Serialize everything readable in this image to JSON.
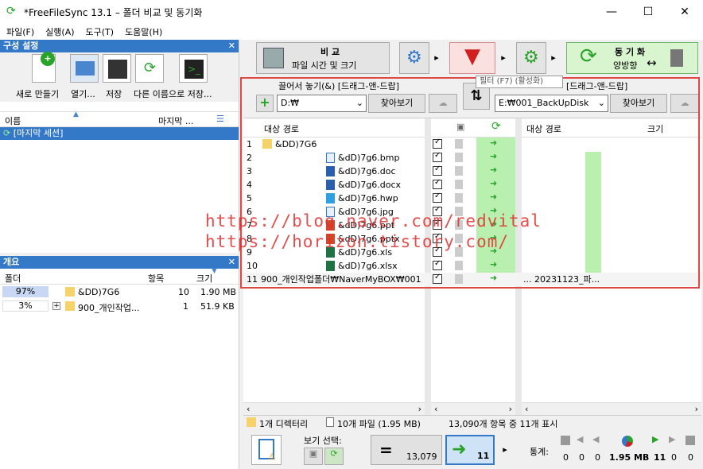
{
  "window": {
    "title": "*FreeFileSync 13.1 – 폴더 비교 및 동기화",
    "min": "—",
    "max": "☐",
    "close": "✕"
  },
  "menu": [
    "파일(F)",
    "실행(A)",
    "도구(T)",
    "도움말(H)"
  ],
  "config_panel": {
    "title": "구성 설정",
    "close": "✕",
    "buttons": [
      "새로 만들기",
      "열기...",
      "저장",
      "다른 이름으로 저장..."
    ],
    "col_name": "이름",
    "col_last": "마지막 ...",
    "session": "[마지막 세션]"
  },
  "overview_panel": {
    "title": "개요",
    "close": "✕",
    "col_folder": "폴더",
    "col_items": "항목",
    "col_size": "크기",
    "rows": [
      {
        "pct": "97%",
        "name": "&DD)7G6",
        "items": "10",
        "size": "1.90 MB"
      },
      {
        "pct": "3%",
        "name": "900_개인작업...",
        "items": "1",
        "size": "51.9 KB"
      }
    ]
  },
  "toolbar": {
    "compare_label": "비 교",
    "compare_sub": "파일 시간 및 크기",
    "sync_label": "동 기 화",
    "sync_sub": "양방향",
    "tooltip": "필터 (F7) (활성화)"
  },
  "left_folder": {
    "drop_label": "끌어서 놓기(&) [드래그-앤-드랍]",
    "path": "D:₩",
    "browse": "찾아보기"
  },
  "right_folder": {
    "drop_label": "[드래그-앤-드랍]",
    "path": "E:₩001_BackUpDisk",
    "browse": "찾아보기"
  },
  "grid": {
    "col_left": "대상 경로",
    "col_right": "대상 경로",
    "col_size": "크기",
    "left_rows": [
      {
        "n": "1",
        "name": "&DD)7G6",
        "folder": true
      },
      {
        "n": "2",
        "name": "&dD)7g6.bmp"
      },
      {
        "n": "3",
        "name": "&dD)7g6.doc"
      },
      {
        "n": "4",
        "name": "&dD)7g6.docx"
      },
      {
        "n": "5",
        "name": "&dD)7g6.hwp"
      },
      {
        "n": "6",
        "name": "&dD)7g6.jpg"
      },
      {
        "n": "7",
        "name": "&dD)7g6.ppt"
      },
      {
        "n": "8",
        "name": "&dD)7g6.pptx"
      },
      {
        "n": "9",
        "name": "&dD)7g6.xls"
      },
      {
        "n": "10",
        "name": "&dD)7g6.xlsx"
      },
      {
        "n": "11",
        "name": "900_개인작업폴더₩NaverMyBOX₩001"
      }
    ],
    "right_last": "... 20231123_파..."
  },
  "watermark": [
    "https://blog.naver.com/redvital",
    "https://horizon.tistory.com/"
  ],
  "statusbar": {
    "dirs": "1개 디렉터리",
    "files": "10개 파일 (1.95 MB)",
    "items": "13,090개 항목 중 11개 표시"
  },
  "bottom": {
    "view_label": "보기 선택:",
    "equal_count": "13,079",
    "create_count": "11",
    "stats_label": "통계:",
    "stats": [
      "0",
      "0",
      "0",
      "1.95 MB",
      "11",
      "0",
      "0"
    ]
  }
}
